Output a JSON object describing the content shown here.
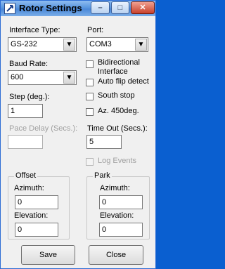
{
  "window": {
    "title": "Rotor Settings",
    "controls": [
      "–",
      "□",
      "✕"
    ]
  },
  "interface": {
    "label": "Interface Type:",
    "value": "GS-232"
  },
  "port": {
    "label": "Port:",
    "value": "COM3"
  },
  "baud": {
    "label": "Baud Rate:",
    "value": "600"
  },
  "checks": {
    "bidir_1": "Bidirectional",
    "bidir_2": "Interface",
    "auto_flip": "Auto flip detect",
    "south_stop": "South stop",
    "az450": "Az. 450deg."
  },
  "step": {
    "label": "Step (deg.):",
    "value": "1"
  },
  "pace": {
    "label": "Pace Delay (Secs.):",
    "value": ""
  },
  "timeout": {
    "label": "Time Out (Secs.):",
    "value": "5"
  },
  "log_events": {
    "label": "Log Events"
  },
  "offset": {
    "legend": "Offset",
    "azimuth_label": "Azimuth:",
    "azimuth_value": "0",
    "elevation_label": "Elevation:",
    "elevation_value": "0"
  },
  "park": {
    "legend": "Park",
    "azimuth_label": "Azimuth:",
    "azimuth_value": "0",
    "elevation_label": "Elevation:",
    "elevation_value": "0"
  },
  "buttons": {
    "save": "Save",
    "close": "Close"
  },
  "dropdown_arrow": "▼"
}
